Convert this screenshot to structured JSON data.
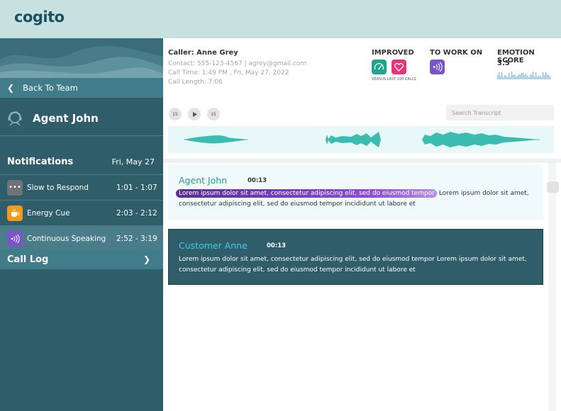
{
  "app": {
    "logo": "cogito"
  },
  "sidebar": {
    "back_label": "Back To Team",
    "agent_name": "Agent John",
    "notifications_title": "Notifications",
    "notifications_date": "Fri, May 27",
    "items": [
      {
        "label": "Slow to Respond",
        "time": "1:01 - 1:07",
        "icon": "dots-icon",
        "color": "#6e7378"
      },
      {
        "label": "Energy Cue",
        "time": "2:03 - 2:12",
        "icon": "coffee-cup-icon",
        "color": "#f29a1e"
      },
      {
        "label": "Continuous Speaking",
        "time": "2:52 - 3:19",
        "icon": "sound-waves-icon",
        "color": "#7a55c8"
      }
    ],
    "call_log_label": "Call Log"
  },
  "call": {
    "caller": "Caller: Anne Grey",
    "contact": "Contact: 555-123-4567 | agrey@gmail.com",
    "time": "Call Time: 1:49 PM , Fri, May 27, 2022",
    "length": "Call Length: 7:06"
  },
  "kpis": {
    "improved_label": "IMPROVED",
    "improved_sub": "VERSUS LAST 100 CALLS",
    "work_on_label": "TO WORK ON",
    "emotion_label": "EMOTION SCORE",
    "emotion_value": "3.5",
    "colors": {
      "speedometer": "#1fa58f",
      "heart": "#e8357a",
      "sound": "#7a55c8",
      "sparkline": "#7fb7e0"
    }
  },
  "player": {
    "rewind_label": "15",
    "forward_label": "15",
    "search_placeholder": "Search Transcript"
  },
  "transcript": [
    {
      "speaker": "Agent John",
      "time": "00:13",
      "highlight": "Lorem ipsum dolor sit amet, consectetur adipiscing elit, sed do eiusmod tempor",
      "line1_rest": " Lorem ipsum dolor sit amet,",
      "line2": "consectetur adipiscing elit, sed do eiusmod tempor incididunt ut labore et"
    },
    {
      "speaker": "Customer Anne",
      "time": "00:13",
      "line1": "Lorem ipsum dolor sit amet, consectetur adipiscing elit, sed do eiusmod tempor Lorem ipsum dolor sit amet,",
      "line2": "consectetur adipiscing elit, sed do eiusmod tempor incididunt ut labore et"
    }
  ]
}
